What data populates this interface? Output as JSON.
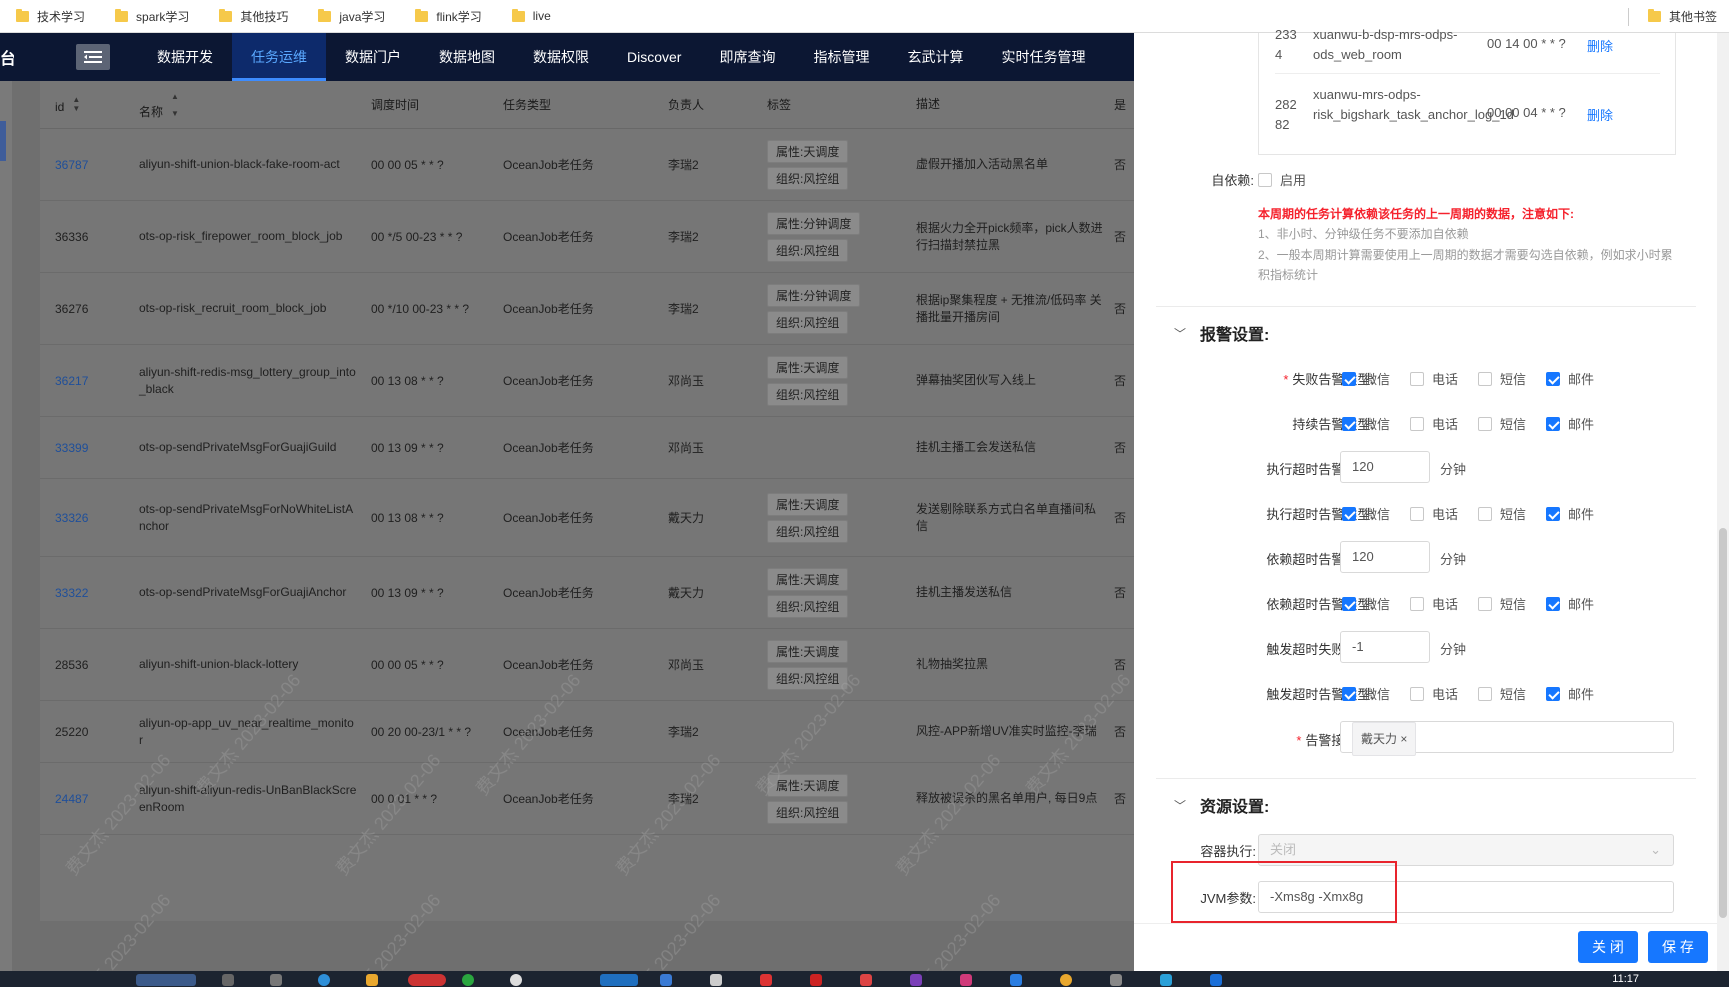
{
  "bookmarks": {
    "items": [
      "技术学习",
      "spark学习",
      "其他技巧",
      "java学习",
      "flink学习",
      "live"
    ],
    "right": "其他书签"
  },
  "nav": {
    "logo_fragment": "台",
    "items": [
      "数据开发",
      "任务运维",
      "数据门户",
      "数据地图",
      "数据权限",
      "Discover",
      "即席查询",
      "指标管理",
      "玄武计算",
      "实时任务管理"
    ],
    "active": "任务运维"
  },
  "table": {
    "headers": [
      "id",
      "名称",
      "调度时间",
      "任务类型",
      "负责人",
      "标签",
      "描述",
      "是"
    ],
    "rows": [
      {
        "id": "36787",
        "name": "aliyun-shift-union-black-fake-room-act",
        "time": "00 00 05 * * ?",
        "type": "OceanJob老任务",
        "owner": "李瑞2",
        "tags": [
          "属性:天调度",
          "组织:风控组"
        ],
        "desc": "虚假开播加入活动黑名单",
        "more": "否",
        "link": true
      },
      {
        "id": "36336",
        "name": "ots-op-risk_firepower_room_block_job",
        "time": "00 */5 00-23 * * ?",
        "type": "OceanJob老任务",
        "owner": "李瑞2",
        "tags": [
          "属性:分钟调度",
          "组织:风控组"
        ],
        "desc": "根据火力全开pick频率，pick人数进行扫描封禁拉黑",
        "more": "否",
        "link": false
      },
      {
        "id": "36276",
        "name": "ots-op-risk_recruit_room_block_job",
        "time": "00 */10 00-23 * * ?",
        "type": "OceanJob老任务",
        "owner": "李瑞2",
        "tags": [
          "属性:分钟调度",
          "组织:风控组"
        ],
        "desc": "根据ip聚集程度 + 无推流/低码率 关播批量开播房间",
        "more": "否",
        "link": false
      },
      {
        "id": "36217",
        "name": "aliyun-shift-redis-msg_lottery_group_into_black",
        "time": "00 13 08 * * ?",
        "type": "OceanJob老任务",
        "owner": "邓尚玉",
        "tags": [
          "属性:天调度",
          "组织:风控组"
        ],
        "desc": "弹幕抽奖团伙写入线上",
        "more": "否",
        "link": true
      },
      {
        "id": "33399",
        "name": "ots-op-sendPrivateMsgForGuajiGuild",
        "time": "00 13 09 * * ?",
        "type": "OceanJob老任务",
        "owner": "邓尚玉",
        "tags": [],
        "desc": "挂机主播工会发送私信",
        "more": "否",
        "link": true
      },
      {
        "id": "33326",
        "name": "ots-op-sendPrivateMsgForNoWhiteListAnchor",
        "time": "00 13 08 * * ?",
        "type": "OceanJob老任务",
        "owner": "戴天力",
        "tags": [
          "属性:天调度",
          "组织:风控组"
        ],
        "desc": "发送剔除联系方式白名单直播间私信",
        "more": "否",
        "link": true
      },
      {
        "id": "33322",
        "name": "ots-op-sendPrivateMsgForGuajiAnchor",
        "time": "00 13 09 * * ?",
        "type": "OceanJob老任务",
        "owner": "戴天力",
        "tags": [
          "属性:天调度",
          "组织:风控组"
        ],
        "desc": "挂机主播发送私信",
        "more": "否",
        "link": true
      },
      {
        "id": "28536",
        "name": "aliyun-shift-union-black-lottery",
        "time": "00 00 05 * * ?",
        "type": "OceanJob老任务",
        "owner": "邓尚玉",
        "tags": [
          "属性:天调度",
          "组织:风控组"
        ],
        "desc": "礼物抽奖拉黑",
        "more": "否",
        "link": false
      },
      {
        "id": "25220",
        "name": "aliyun-op-app_uv_near_realtime_monitor",
        "time": "00 20 00-23/1 * * ?",
        "type": "OceanJob老任务",
        "owner": "李瑞2",
        "tags": [],
        "desc": "风控-APP新增UV准实时监控-李瑞",
        "more": "否",
        "link": false
      },
      {
        "id": "24487",
        "name": "aliyun-shift-aliyun-redis-UnBanBlackScreenRoom",
        "time": "00 0 01 * * ?",
        "type": "OceanJob老任务",
        "owner": "李瑞2",
        "tags": [
          "属性:天调度",
          "组织:风控组"
        ],
        "desc": "释放被误杀的黑名单用户, 每日9点",
        "more": "否",
        "link": true
      }
    ]
  },
  "watermark": {
    "name": "费文杰",
    "date": "2023-02-06"
  },
  "drawer": {
    "deps": [
      {
        "id": "233\n4",
        "name": "xuanwu-b-dsp-mrs-odps-ods_web_room",
        "cron": "00 14 00 * * ?",
        "del": "删除"
      },
      {
        "id": "282\n82",
        "name": "xuanwu-mrs-odps-risk_bigshark_task_anchor_log_1d",
        "cron": "00 00 04 * * ?",
        "del": "删除"
      }
    ],
    "self_dep": {
      "label": "自依赖:",
      "option": "启用"
    },
    "notice": {
      "title": "本周期的任务计算依赖该任务的上一周期的数据，注意如下:",
      "line1": "1、非小时、分钟级任务不要添加自依赖",
      "line2": "2、一般本周期计算需要使用上一周期的数据才需要勾选自依赖，例如求小时累积指标统计"
    },
    "alarm": {
      "title": "报警设置:",
      "options": [
        "微信",
        "电话",
        "短信",
        "邮件"
      ],
      "rows": [
        {
          "label": "失败告警类型:",
          "required": true,
          "checked": [
            true,
            false,
            false,
            true
          ]
        },
        {
          "label": "持续告警类型:",
          "required": false,
          "checked": [
            true,
            false,
            false,
            true
          ]
        },
        {
          "label": "执行超时告警阈值:",
          "value": "120",
          "unit": "分钟"
        },
        {
          "label": "执行超时告警类型:",
          "checked": [
            true,
            false,
            false,
            true
          ]
        },
        {
          "label": "依赖超时告警阈值:",
          "value": "120",
          "unit": "分钟"
        },
        {
          "label": "依赖超时告警类型:",
          "checked": [
            true,
            false,
            false,
            true
          ]
        },
        {
          "label": "触发超时失败阈值:",
          "value": "-1",
          "unit": "分钟"
        },
        {
          "label": "触发超时告警类型:",
          "checked": [
            true,
            false,
            false,
            true
          ]
        }
      ],
      "receiver_label": "告警接收人:",
      "receiver": "戴天力"
    },
    "resource": {
      "title": "资源设置:",
      "container_label": "容器执行:",
      "container_value": "关闭",
      "jvm_label": "JVM参数:",
      "jvm_value": "-Xms8g -Xmx8g"
    },
    "buttons": {
      "close": "关 闭",
      "save": "保 存"
    }
  },
  "taskbar": {
    "time": "11:17"
  }
}
